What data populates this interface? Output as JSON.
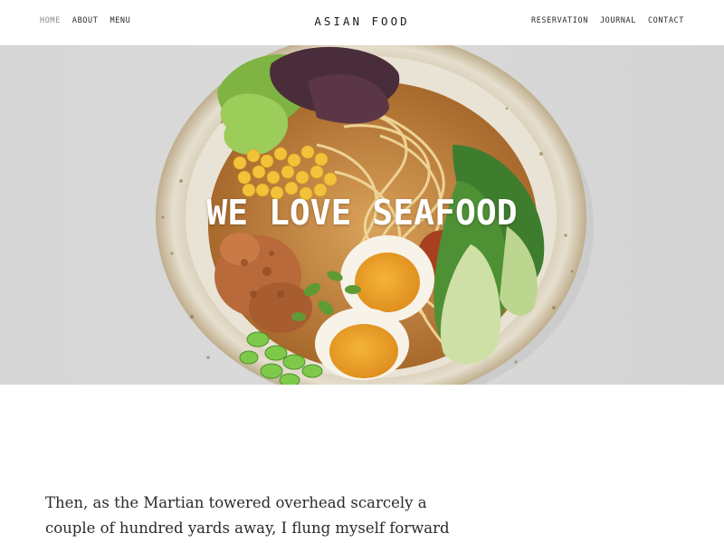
{
  "header": {
    "nav_left": [
      {
        "label": "HOME",
        "active": true
      },
      {
        "label": "ABOUT",
        "active": false
      },
      {
        "label": "MENU",
        "active": false
      }
    ],
    "brand": "ASIAN FOOD",
    "nav_right": [
      {
        "label": "RESERVATION"
      },
      {
        "label": "JOURNAL"
      },
      {
        "label": "CONTACT"
      }
    ]
  },
  "hero": {
    "title": "WE LOVE SEAFOOD"
  },
  "intro": {
    "text": "Then, as the Martian towered overhead scarcely a couple of hundred yards away, I flung myself forward under the surface."
  }
}
